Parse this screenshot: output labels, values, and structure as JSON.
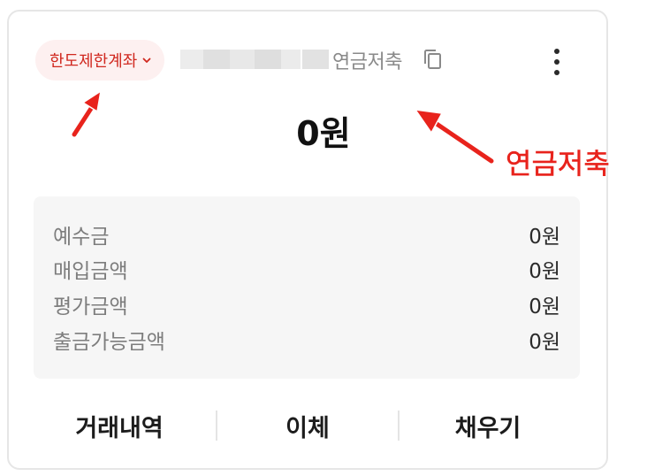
{
  "account": {
    "limit_badge": "한도제한계좌",
    "type_label": "연금저축",
    "balance": "0원"
  },
  "details": [
    {
      "label": "예수금",
      "value": "0원"
    },
    {
      "label": "매입금액",
      "value": "0원"
    },
    {
      "label": "평가금액",
      "value": "0원"
    },
    {
      "label": "출금가능금액",
      "value": "0원"
    }
  ],
  "actions": {
    "history": "거래내역",
    "transfer": "이체",
    "fill": "채우기"
  },
  "annotation": {
    "label": "연금저축",
    "color": "#e8231c"
  },
  "icons": {
    "badge": "chevron-down-icon",
    "copy": "copy-icon",
    "more": "more-vertical-icon"
  },
  "colors": {
    "badge_text": "#d0281f",
    "badge_bg": "#fdf0f0",
    "panel_bg": "#f6f6f6"
  }
}
